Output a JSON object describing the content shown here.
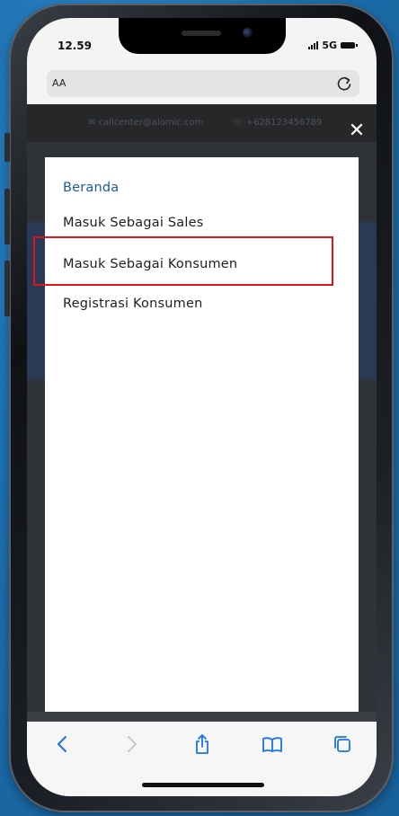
{
  "status_bar": {
    "time": "12.59",
    "network": "5G"
  },
  "address_bar": {
    "aa_label": "AA",
    "reload_icon": "reload-icon"
  },
  "page_topbar": {
    "email": "✉ callcenter@alomic.com",
    "phone": "☏ +628123456789"
  },
  "menu": {
    "close_icon": "close-icon",
    "items": [
      {
        "label": "Beranda",
        "active": true
      },
      {
        "label": "Masuk Sebagai Sales",
        "active": false
      },
      {
        "label": "Masuk Sebagai Konsumen",
        "active": false,
        "highlighted": true
      },
      {
        "label": "Registrasi Konsumen",
        "active": false
      }
    ]
  },
  "toolbar": {
    "icons": [
      "back-icon",
      "forward-icon",
      "share-icon",
      "bookmarks-icon",
      "tabs-icon"
    ]
  },
  "colors": {
    "active_link": "#1c5c9e",
    "highlight_border": "#e0141b",
    "toolbar_tint": "#1a73e8"
  }
}
